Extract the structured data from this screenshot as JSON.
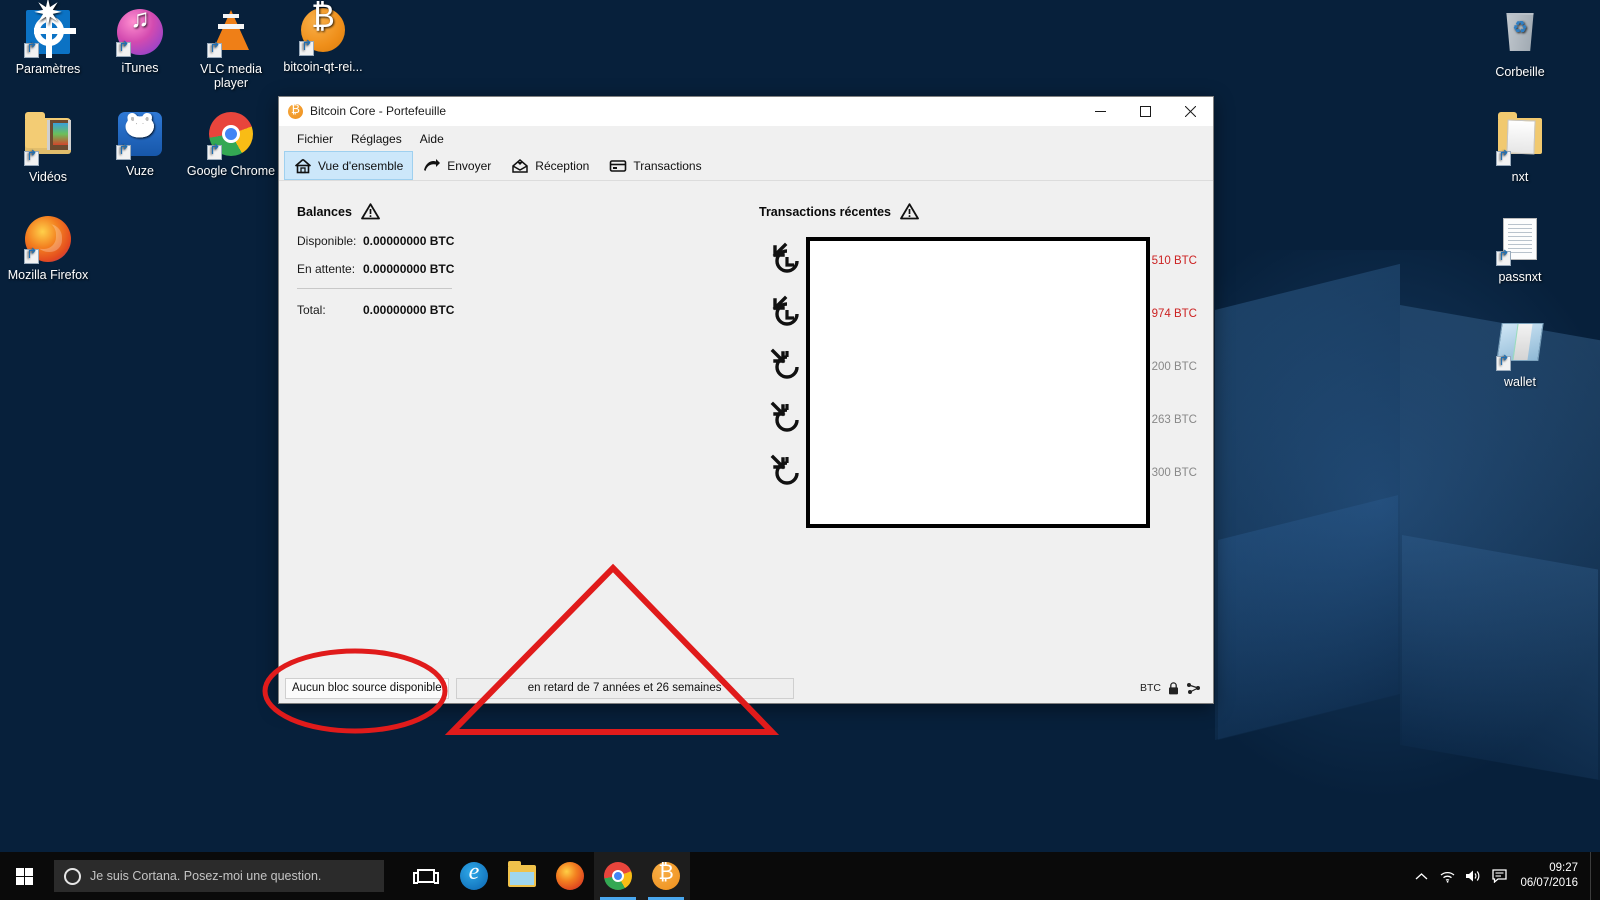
{
  "desktop": {
    "icons_left": [
      {
        "label": "Paramètres",
        "icon": "settings-icon"
      },
      {
        "label": "iTunes",
        "icon": "itunes-icon"
      },
      {
        "label": "VLC media player",
        "icon": "vlc-icon"
      },
      {
        "label": "bitcoin-qt-rei...",
        "icon": "bitcoin-icon"
      },
      {
        "label": "Vidéos",
        "icon": "videos-folder-icon"
      },
      {
        "label": "Vuze",
        "icon": "vuze-icon"
      },
      {
        "label": "Google Chrome",
        "icon": "chrome-icon"
      },
      {
        "label": "Mozilla Firefox",
        "icon": "firefox-icon"
      }
    ],
    "icons_right": [
      {
        "label": "Corbeille",
        "icon": "recycle-bin-icon"
      },
      {
        "label": "nxt",
        "icon": "folder-icon"
      },
      {
        "label": "passnxt",
        "icon": "text-document-icon"
      },
      {
        "label": "wallet",
        "icon": "wallet-file-icon"
      }
    ]
  },
  "window": {
    "title": "Bitcoin Core - Portefeuille",
    "app_icon": "bitcoin-icon",
    "controls": {
      "minimize": "—",
      "maximize": "☐",
      "close": "✕"
    },
    "menu": [
      {
        "label": "Fichier"
      },
      {
        "label": "Réglages"
      },
      {
        "label": "Aide"
      }
    ],
    "tabs": [
      {
        "label": "Vue d'ensemble",
        "icon": "home-icon",
        "active": true
      },
      {
        "label": "Envoyer",
        "icon": "send-arrow-icon",
        "active": false
      },
      {
        "label": "Réception",
        "icon": "receive-inbox-icon",
        "active": false
      },
      {
        "label": "Transactions",
        "icon": "card-icon",
        "active": false
      }
    ],
    "balances": {
      "heading": "Balances",
      "warning_icon": "warning-triangle-icon",
      "rows": [
        {
          "label": "Disponible:",
          "value": "0.00000000 BTC"
        },
        {
          "label": "En attente:",
          "value": "0.00000000 BTC"
        }
      ],
      "total": {
        "label": "Total:",
        "value": "0.00000000 BTC"
      }
    },
    "recent_transactions": {
      "heading": "Transactions récentes",
      "warning_icon": "warning-triangle-icon",
      "rows": [
        {
          "icon": "outgoing-pending-icon",
          "amount": "510 BTC",
          "sign": "negative"
        },
        {
          "icon": "outgoing-pending-icon",
          "amount": "974 BTC",
          "sign": "negative"
        },
        {
          "icon": "incoming-pending-icon",
          "amount": "200 BTC",
          "sign": "positive"
        },
        {
          "icon": "incoming-pending-icon",
          "amount": "263 BTC",
          "sign": "positive"
        },
        {
          "icon": "incoming-pending-icon",
          "amount": "300 BTC",
          "sign": "positive"
        }
      ]
    },
    "statusbar": {
      "sync_status": "Aucun bloc source disponible",
      "progress_text": "en retard de 7 années et 26 semaines",
      "unit": "BTC",
      "lock_icon": "lock-icon",
      "network_icon": "network-connections-icon"
    }
  },
  "taskbar": {
    "start_icon": "windows-start-icon",
    "search_placeholder": "Je suis Cortana. Posez-moi une question.",
    "cortana_icon": "cortana-circle-icon",
    "apps": [
      {
        "name": "task-view",
        "icon": "task-view-icon",
        "running": false
      },
      {
        "name": "edge",
        "icon": "edge-icon",
        "running": false
      },
      {
        "name": "file-explorer",
        "icon": "file-explorer-icon",
        "running": false
      },
      {
        "name": "firefox",
        "icon": "firefox-icon",
        "running": false
      },
      {
        "name": "chrome",
        "icon": "chrome-icon",
        "running": true
      },
      {
        "name": "bitcoin-core",
        "icon": "bitcoin-icon",
        "running": true
      }
    ],
    "tray": [
      {
        "icon": "chevron-up-icon",
        "glyph": "⌃"
      },
      {
        "icon": "wifi-icon",
        "glyph": "◠"
      },
      {
        "icon": "volume-icon",
        "glyph": "ὐA"
      },
      {
        "icon": "action-center-icon",
        "glyph": "὞8"
      }
    ],
    "clock": {
      "time": "09:27",
      "date": "06/07/2016"
    }
  },
  "annotations": {
    "ellipse_color": "#e01b1b",
    "triangle_color": "#e01b1b",
    "ellipse_target": "Aucun bloc source disponible",
    "triangle_target": "en retard de 7 années et 26 semaines"
  }
}
